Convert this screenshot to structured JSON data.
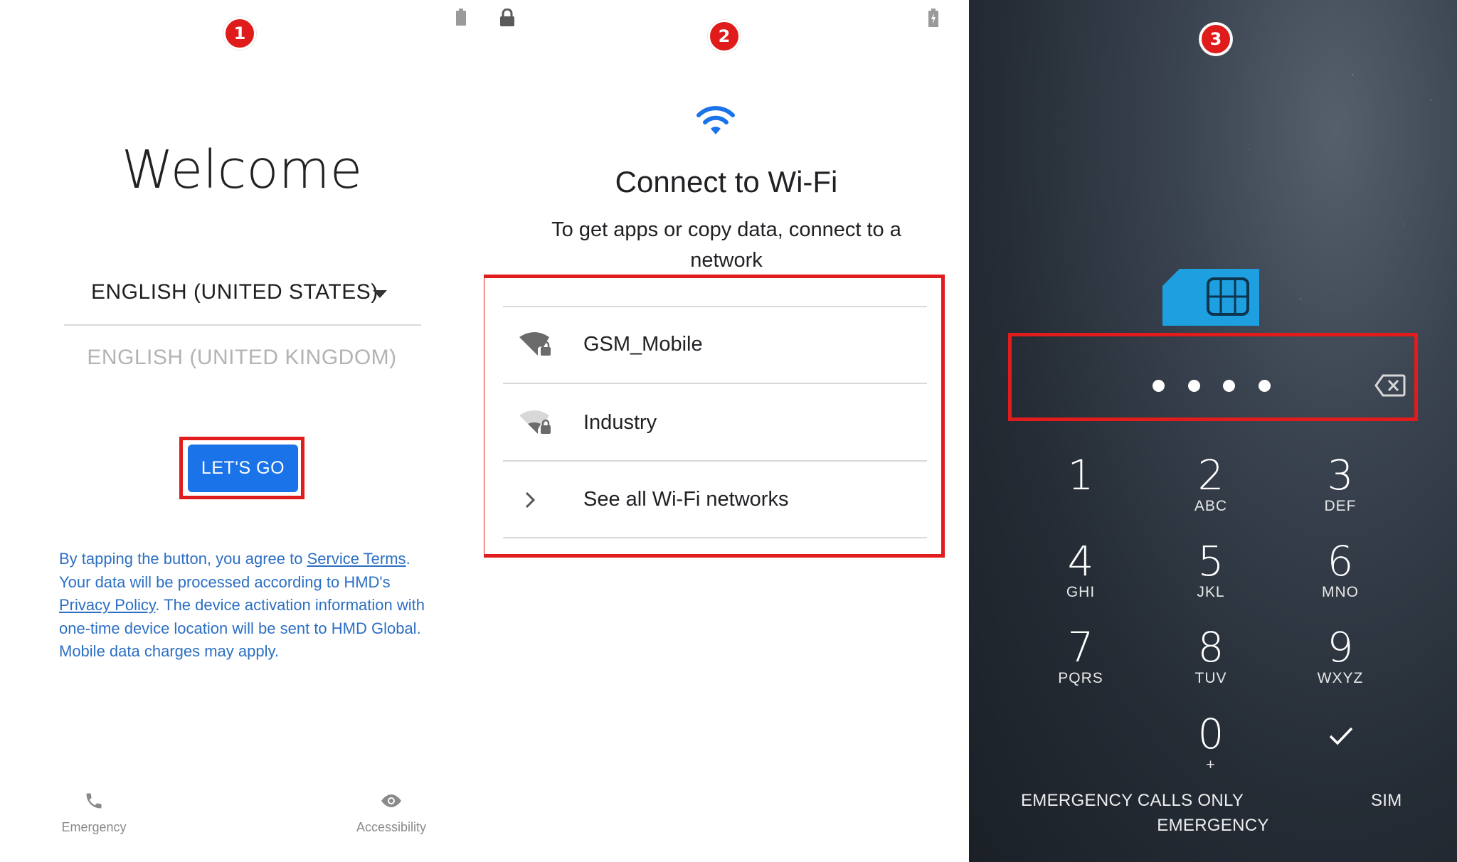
{
  "screen1": {
    "badge": "1",
    "title": "Welcome",
    "selected_language": "ENGLISH (UNITED STATES)",
    "alternate_language": "ENGLISH (UNITED KINGDOM)",
    "lets_go_label": "LET'S GO",
    "legal": {
      "part1": "By tapping the button, you agree to ",
      "service_terms": "Service Terms",
      "part2": ". Your data will be processed according to HMD's ",
      "privacy_policy": "Privacy Policy",
      "part3": ". The device activation information with one-time device location will be sent to HMD Global. Mobile data charges may apply."
    },
    "emergency_label": "Emergency",
    "accessibility_label": "Accessibility"
  },
  "screen2": {
    "badge": "2",
    "title": "Connect to Wi-Fi",
    "subtitle": "To get apps or copy data, connect to a network",
    "networks": [
      {
        "name": "GSM_Mobile",
        "icon": "wifi-lock-strong-icon"
      },
      {
        "name": "Industry",
        "icon": "wifi-lock-weak-icon"
      }
    ],
    "see_all_label": "See all Wi-Fi networks",
    "accent_color": "#1a73e8"
  },
  "screen3": {
    "badge": "3",
    "pin_dots": 4,
    "keys": [
      {
        "digit": "1",
        "letters": ""
      },
      {
        "digit": "2",
        "letters": "ABC"
      },
      {
        "digit": "3",
        "letters": "DEF"
      },
      {
        "digit": "4",
        "letters": "GHI"
      },
      {
        "digit": "5",
        "letters": "JKL"
      },
      {
        "digit": "6",
        "letters": "MNO"
      },
      {
        "digit": "7",
        "letters": "PQRS"
      },
      {
        "digit": "8",
        "letters": "TUV"
      },
      {
        "digit": "9",
        "letters": "WXYZ"
      },
      {
        "digit": "0",
        "letters": "+"
      }
    ],
    "confirm_icon": "check-icon",
    "delete_icon": "backspace-icon",
    "emergency_calls_only": "EMERGENCY CALLS ONLY",
    "sim_text": "SIM",
    "emergency_button": "EMERGENCY",
    "sim_color": "#1e9fe0"
  },
  "highlight_color": "#e11c1c"
}
